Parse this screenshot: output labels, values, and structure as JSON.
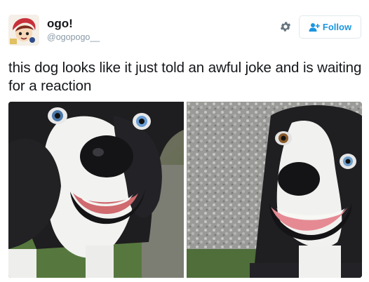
{
  "author": {
    "display_name": "ogo!",
    "handle": "@ogopogo__",
    "avatar_icon": "cartoon-avatar"
  },
  "actions": {
    "settings_icon": "gear-icon",
    "follow_label": "Follow",
    "follow_icon": "add-user-icon"
  },
  "tweet": {
    "text": "this dog looks like it just told an awful joke and is waiting for a reaction"
  },
  "media": {
    "photos": [
      {
        "description_icon": "dog-photo"
      },
      {
        "description_icon": "dog-photo"
      }
    ]
  },
  "colors": {
    "accent": "#1b95e0",
    "text": "#14171a",
    "muted": "#8899a6",
    "border": "#e1e8ed"
  }
}
